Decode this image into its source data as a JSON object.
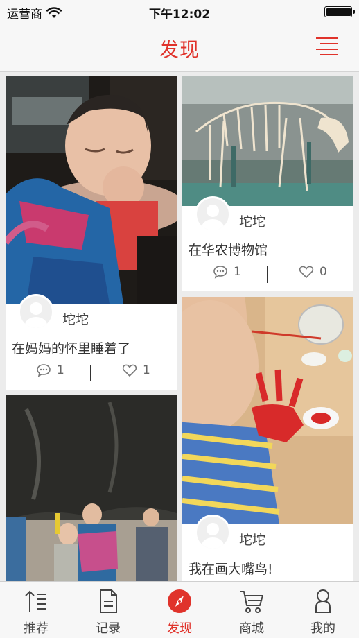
{
  "status_bar": {
    "carrier": "运营商",
    "time": "下午12:02"
  },
  "header": {
    "title": "发现"
  },
  "feed": [
    {
      "author": "坨坨",
      "caption": "在妈妈的怀里睡着了",
      "comments": "1",
      "likes": "1"
    },
    {
      "author": "坨坨",
      "caption": "在华农博物馆",
      "comments": "1",
      "likes": "0"
    },
    {
      "author": "坨坨",
      "caption": "我在画大嘴鸟!"
    }
  ],
  "tabs": [
    {
      "label": "推荐",
      "icon": "recommend-icon"
    },
    {
      "label": "记录",
      "icon": "record-icon"
    },
    {
      "label": "发现",
      "icon": "discover-icon"
    },
    {
      "label": "商城",
      "icon": "shop-cart-icon"
    },
    {
      "label": "我的",
      "icon": "profile-icon"
    }
  ],
  "colors": {
    "accent": "#e0332b",
    "background": "#ececec",
    "bar": "#f7f7f7"
  }
}
